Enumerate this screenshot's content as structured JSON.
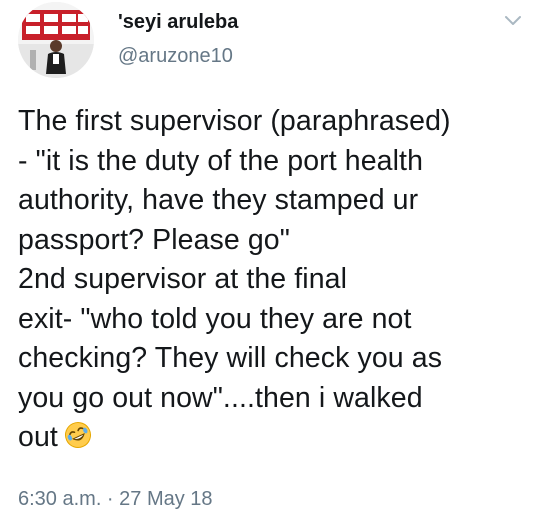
{
  "user": {
    "display_name": "'seyi aruleba",
    "handle": "@aruzone10"
  },
  "tweet": {
    "lines": [
      "The first supervisor (paraphrased)",
      "- \"it is the duty of the port health",
      "authority,  have they stamped ur",
      "passport? Please go\"",
      "2nd supervisor at the final",
      "exit-  \"who told you they are not",
      "checking?  They will check you as",
      "you go out now\"....then i walked",
      "out"
    ],
    "emoji": "rolling-on-the-floor-laughing-emoji"
  },
  "meta": {
    "timestamp": "6:30 a.m. · 27 May 18"
  },
  "colors": {
    "text": "#14171a",
    "secondary": "#657786",
    "caret": "#aab8c2",
    "emoji_face": "#ffcc4d"
  },
  "icons": {
    "caret": "chevron-down-icon",
    "avatar": "profile-photo"
  }
}
